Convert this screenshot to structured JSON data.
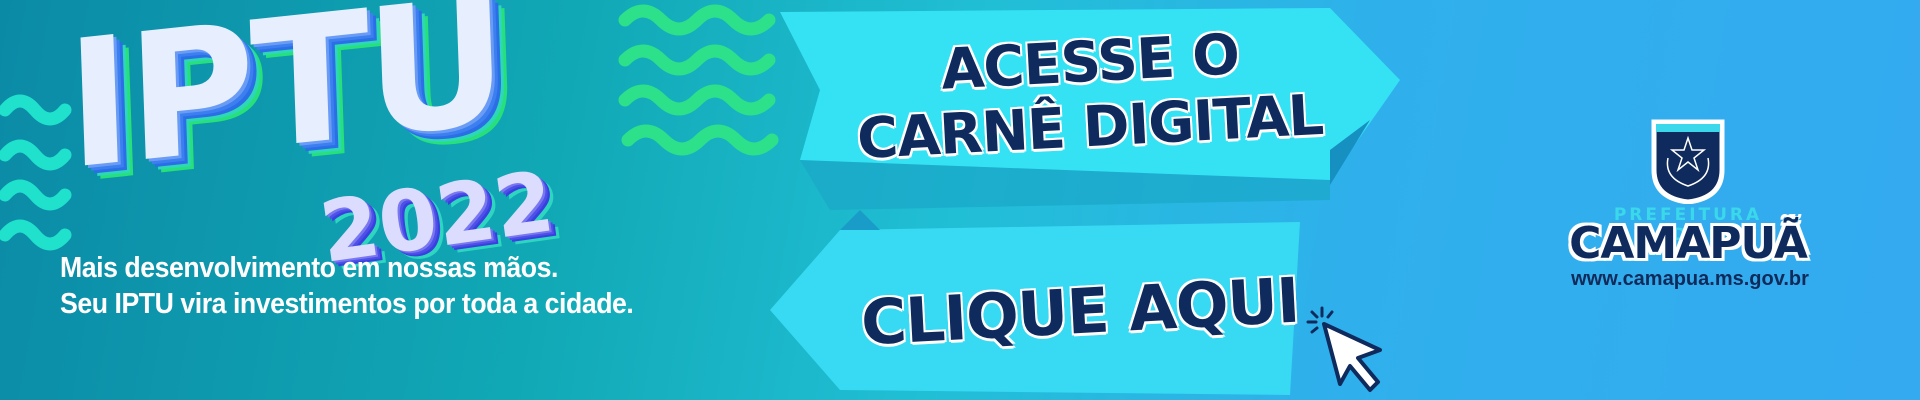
{
  "banner": {
    "title": "IPTU",
    "year": "2022",
    "tagline_line1": "Mais desenvolvimento em nossas mãos.",
    "tagline_line2": "Seu IPTU vira investimentos por toda a cidade.",
    "cta_top_line1": "ACESSE O",
    "cta_top_line2": "CARNÊ DIGITAL",
    "cta_button": "CLIQUE AQUI",
    "cursor_icon": "pointer-click-icon"
  },
  "logo": {
    "prefix": "PREFEITURA DE",
    "name": "CAMAPUÃ",
    "url": "www.camapua.ms.gov.br",
    "emblem_icon": "coat-of-arms-icon"
  },
  "colors": {
    "navy": "#0f2a5c",
    "cyan_arrow": "#33e4f4",
    "green_wave": "#2de08a",
    "teal_wave": "#20e0d0"
  }
}
